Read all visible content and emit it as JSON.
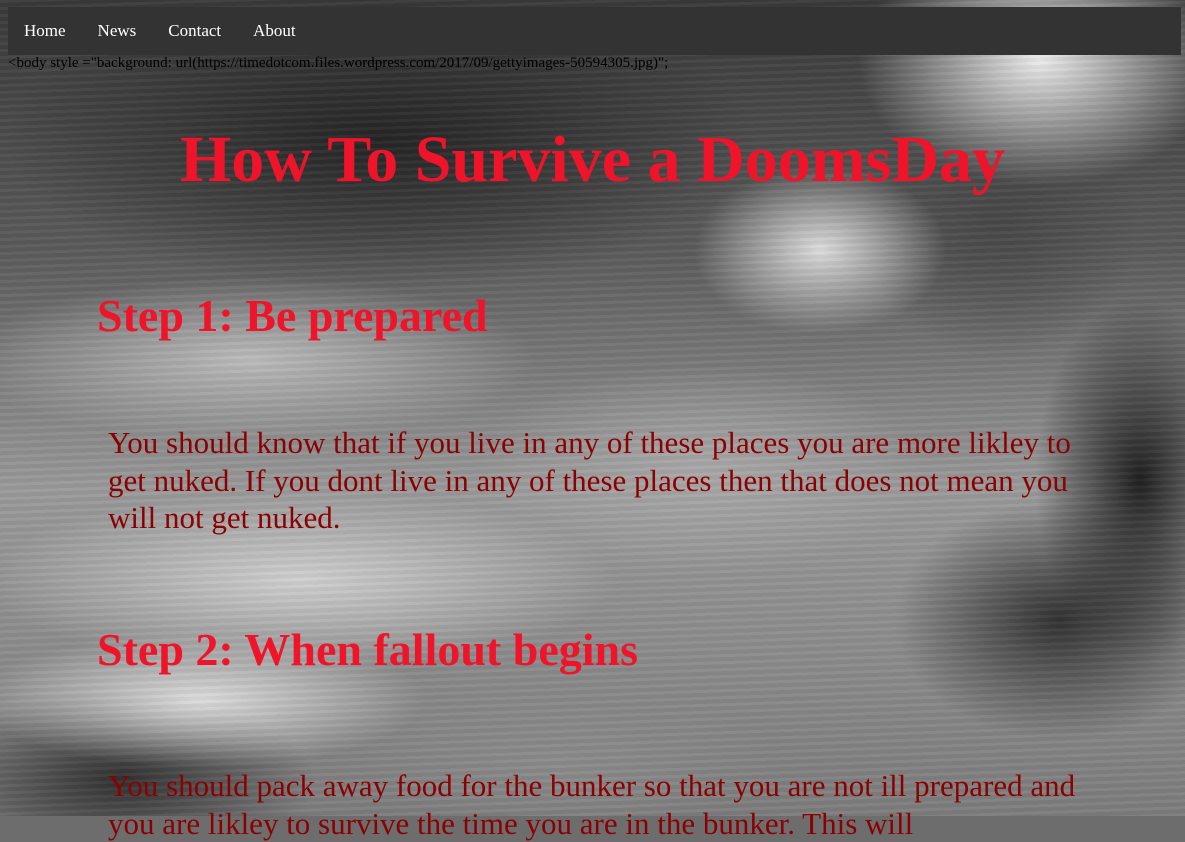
{
  "nav": {
    "items": [
      {
        "label": "Home"
      },
      {
        "label": "News"
      },
      {
        "label": "Contact"
      },
      {
        "label": "About"
      }
    ]
  },
  "raw_text": "<body style =\"background: url(https://timedotcom.files.wordpress.com/2017/09/gettyimages-50594305.jpg)\";",
  "title": "How To Survive a DoomsDay",
  "steps": [
    {
      "heading": "Step 1: Be prepared",
      "text": "You should know that if you live in any of these places you are more likley to get nuked. If you dont live in any of these places then that does not mean you will not get nuked."
    },
    {
      "heading": "Step 2: When fallout begins",
      "text": "You should pack away food for the bunker so that you are not ill prepared and you are likley to survive the time you are in the bunker. This will"
    }
  ],
  "colors": {
    "navbar": "#333333",
    "heading": "#f0142a",
    "body_text": "#8b0000"
  }
}
